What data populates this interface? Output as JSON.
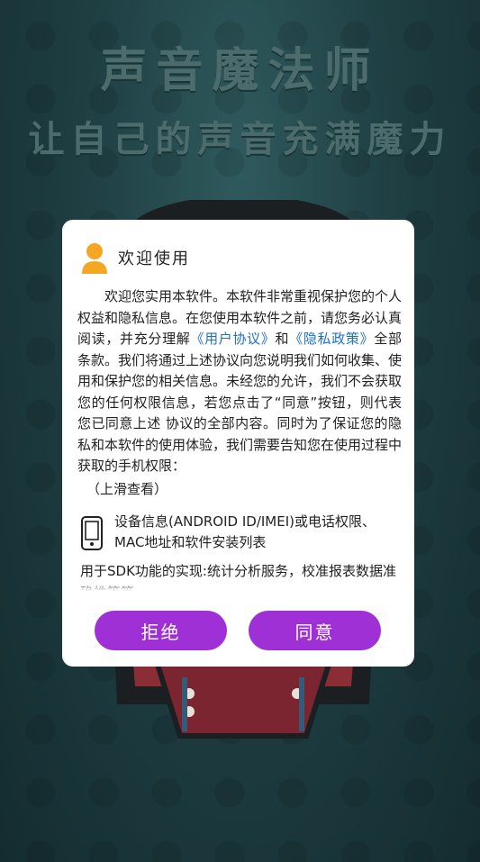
{
  "app": {
    "title": "声音魔法师",
    "subtitle": "让自己的声音充满魔力"
  },
  "dialog": {
    "title": "欢迎使用",
    "body": {
      "part1": "欢迎您实用本软件。本软件非常重视保护您的个人权益和隐私信息。在您使用本软件之前，请您务必认真阅读，并充分理解",
      "link_user_agreement": "《用户协议》",
      "and": "和",
      "link_privacy_policy": "《隐私政策》",
      "part2": "全部条款。我们将通过上述协议向您说明我们如何收集、使用和保护您的相关信息。未经您的允许，我们不会获取您的任何权限信息，若您点击了“同意”按钮，则代表您已同意上述 协议的全部内容。同时为了保证您的隐私和本软件的使用体验，我们需要告知您在使用过程中获取的手机权限：",
      "scroll_hint": "（上滑查看）"
    },
    "permission": {
      "icon": "phone-icon",
      "text": "设备信息(ANDROID ID/IMEI)或电话权限、MAC地址和软件安装列表",
      "description": "用于SDK功能的实现:统计分析服务，校准报表数据准确性等等"
    },
    "buttons": {
      "reject": "拒绝",
      "agree": "同意"
    }
  },
  "colors": {
    "accent": "#9f30d6",
    "link": "#1f6fc8",
    "background": "#1f3f43",
    "avatar": "#f5a623"
  }
}
